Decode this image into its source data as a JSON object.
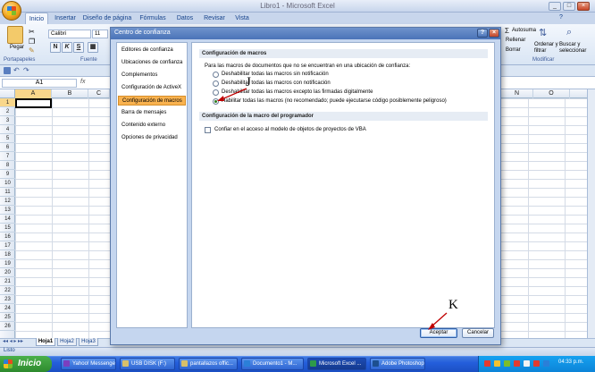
{
  "window": {
    "title": "Libro1 - Microsoft Excel",
    "controls": [
      "_",
      "□",
      "×"
    ]
  },
  "ribbon": {
    "tabs": [
      "Inicio",
      "Insertar",
      "Diseño de página",
      "Fórmulas",
      "Datos",
      "Revisar",
      "Vista"
    ],
    "paste_label": "Pegar",
    "font_name": "Calibri",
    "font_size": "11",
    "bold": "N",
    "italic": "K",
    "underline": "S",
    "group_clipboard": "Portapapeles",
    "group_font": "Fuente",
    "group_modify": "Modificar",
    "autosum": "Autosuma",
    "fill": "Rellenar",
    "clear": "Borrar",
    "sort_filter": "Ordenar y filtrar",
    "find_select": "Buscar y seleccionar"
  },
  "formula_bar": {
    "name_box": "A1"
  },
  "sheet": {
    "col_headers_left": [
      "A",
      "B",
      "C"
    ],
    "col_headers_right": [
      "N",
      "O"
    ],
    "row_headers": [
      "1",
      "2",
      "3",
      "4",
      "5",
      "6",
      "7",
      "8",
      "9",
      "10",
      "11",
      "12",
      "13",
      "14",
      "15",
      "16",
      "17",
      "18",
      "19",
      "20",
      "21",
      "22",
      "23",
      "24",
      "25",
      "26"
    ],
    "tabs": [
      "Hoja1",
      "Hoja2",
      "Hoja3"
    ]
  },
  "status_bar": {
    "text": "Listo"
  },
  "dialog": {
    "title": "Centro de confianza",
    "help": "?",
    "close": "×",
    "nav_items": [
      "Editores de confianza",
      "Ubicaciones de confianza",
      "Complementos",
      "Configuración de ActiveX",
      "Configuración de macros",
      "Barra de mensajes",
      "Contenido externo",
      "Opciones de privacidad"
    ],
    "macro_section_title": "Configuración de macros",
    "macro_intro": "Para las macros de documentos que no se encuentran en una ubicación de confianza:",
    "macro_options": [
      "Deshabilitar todas las macros sin notificación",
      "Deshabilitar todas las macros con notificación",
      "Deshabilitar todas las macros excepto las firmadas digitalmente",
      "Habilitar todas las macros (no recomendado; puede ejecutarse código posiblemente peligroso)"
    ],
    "selected_macro_option": 3,
    "developer_section_title": "Configuración de la macro del programador",
    "vba_checkbox_label": "Confiar en el acceso al modelo de objetos de proyectos de VBA",
    "vba_checked": false,
    "accept_button": "Aceptar",
    "cancel_button": "Cancelar"
  },
  "annotations": {
    "j_label": "J",
    "k_label": "K"
  },
  "taskbar": {
    "start": "Inicio",
    "items": [
      "Yahoo! Messenger",
      "USB DISK (F:)",
      "pantallazos offic...",
      "Documento1 - M...",
      "Microsoft Excel ...",
      "Adobe Photoshop"
    ],
    "clock": "04:33 p.m."
  }
}
